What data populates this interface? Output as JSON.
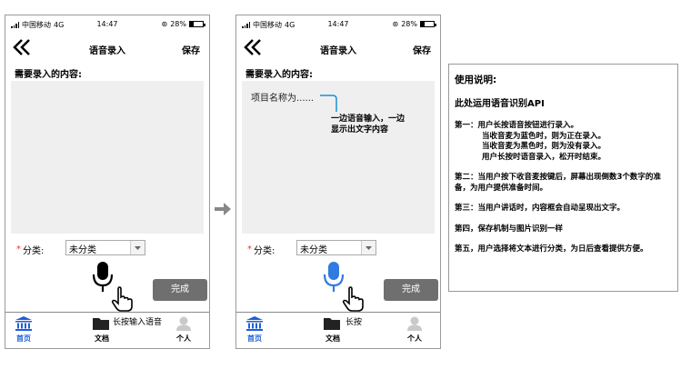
{
  "status_bar": {
    "carrier": "中国移动",
    "network": "4G",
    "time": "14:47",
    "battery": "28%",
    "battery_level": 0.28
  },
  "nav": {
    "title": "语音录入",
    "save": "保存"
  },
  "form": {
    "content_label": "需要录入的内容:",
    "category_label": "分类:",
    "category_value": "未分类",
    "done": "完成"
  },
  "phone2_text": {
    "typed": "项目名称为......",
    "callout": [
      "一边语音输入，一边",
      "显示出文字内容"
    ]
  },
  "hints": {
    "long_press_input": "长按输入语音",
    "long_press": "长按"
  },
  "tabs": [
    {
      "label": "首页",
      "icon": "bank-icon"
    },
    {
      "label": "文档",
      "icon": "folder-icon"
    },
    {
      "label": "个人",
      "icon": "person-icon"
    }
  ],
  "colors": {
    "active_tab": "#1f5fd6",
    "mic_idle": "#000000",
    "mic_recording": "#2f7be0",
    "callout_line": "#1a8fd6",
    "done_button": "#6f6f6f"
  },
  "instructions": {
    "heading": "使用说明:",
    "subheading": "此处运用语音识别API",
    "step1": "第一：用户长按语音按钮进行录入。",
    "step1_a": "当收音麦为蓝色时，则为正在录入。",
    "step1_b": "当收音麦为黑色时，则为没有录入。",
    "step1_c": "用户长按时语音录入，松开时结束。",
    "step2": "第二：当用户按下收音麦按键后，屏幕出现倒数3个数字的准备，为用户提供准备时间。",
    "step3": "第三：当用户讲话时，内容框会自动呈现出文字。",
    "step4": "第四，保存机制与图片识别一样",
    "step5": "第五，用户选择将文本进行分类，为日后查看提供方便。"
  }
}
